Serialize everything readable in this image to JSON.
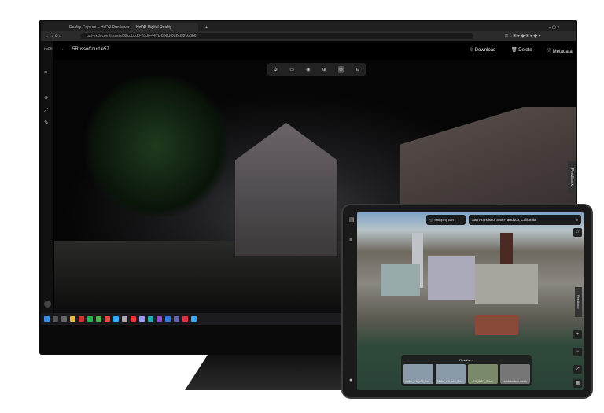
{
  "browser": {
    "tabs": [
      {
        "label": "Reality Capture – HxDR Preview"
      },
      {
        "label": "HxDR Digital Reality"
      }
    ],
    "url": "uat-hxdr.com/assets/02cdbcd8-20d0-447b-858d-0b2c8f2bb6b0"
  },
  "app": {
    "logo": "HxDR",
    "file_name": "5RussoCourt.e57",
    "actions": {
      "download": "Download",
      "delete": "Delete",
      "metadata": "Metadata"
    },
    "feedback": "Feedback"
  },
  "tablet": {
    "location": "San Francisco, San Francisco, California",
    "cart": "Shopping cart",
    "feedback": "Feedback",
    "results": {
      "title": "Results: 4",
      "items": [
        "Metro_CA_c10_Fra...",
        "Metro_CA_c10_Fra...",
        "SA_WAC_30cm",
        "sanfrancisco-mesh"
      ]
    }
  }
}
